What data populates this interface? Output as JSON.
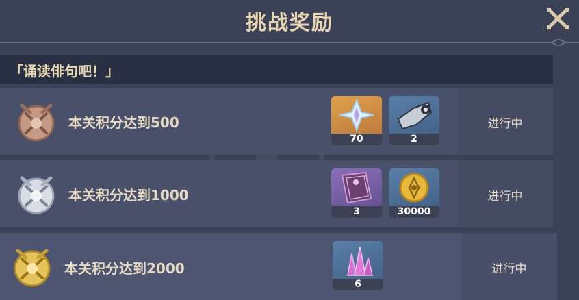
{
  "dialog": {
    "title": "挑战奖励",
    "section_title": "「诵读俳句吧！」"
  },
  "rows": [
    {
      "medal": "bronze-medal-icon",
      "task": "本关积分达到500",
      "status": "进行中",
      "rewards": [
        {
          "icon": "primogem-icon",
          "count": "70"
        },
        {
          "icon": "mora-bag-icon",
          "count": "2"
        }
      ]
    },
    {
      "medal": "silver-medal-icon",
      "task": "本关积分达到1000",
      "status": "进行中",
      "rewards": [
        {
          "icon": "book-icon",
          "count": "3"
        },
        {
          "icon": "gold-coin-icon",
          "count": "30000"
        }
      ]
    },
    {
      "medal": "gold-medal-icon",
      "task": "本关积分达到2000",
      "status": "进行中",
      "rewards": [
        {
          "icon": "crystal-icon",
          "count": "6"
        }
      ]
    }
  ],
  "colors": {
    "background": "#3b4257",
    "title": "#e8d6b0",
    "row": "#48506a",
    "section_bar": "#2a3043"
  }
}
